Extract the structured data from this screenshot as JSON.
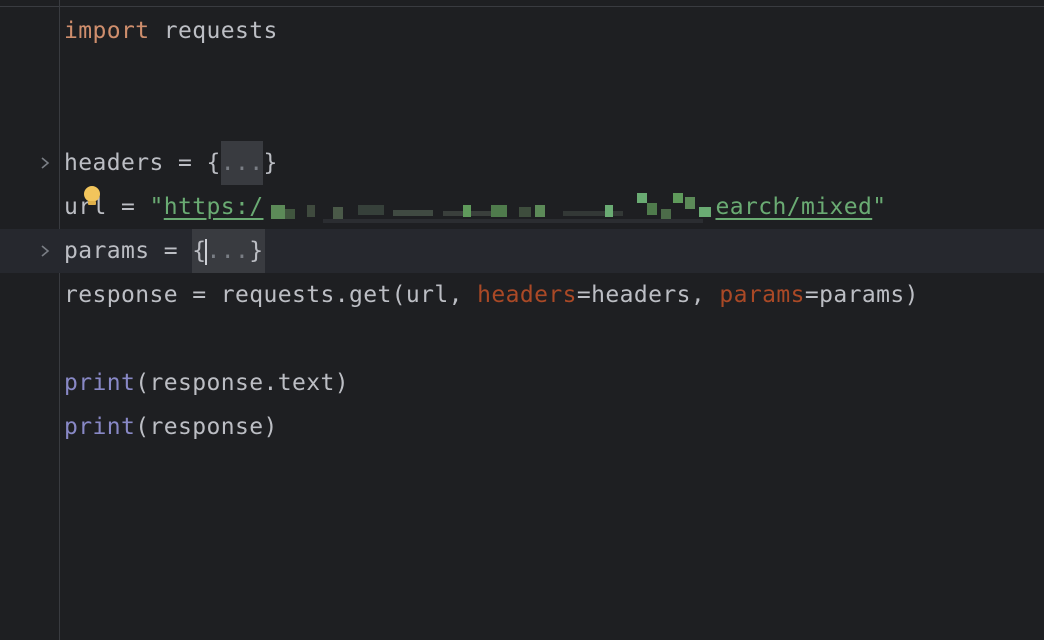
{
  "editor": {
    "language": "python",
    "lines": {
      "l1": {
        "keyword": "import",
        "module": "requests"
      },
      "l4": {
        "name": "headers",
        "op": " = ",
        "open": "{",
        "placeholder": "...",
        "close": "}"
      },
      "l5": {
        "name": "url",
        "op": " = ",
        "quote_open": "\"",
        "url_start": "https:/",
        "url_end": "earch/mixed",
        "quote_close": "\""
      },
      "l6": {
        "name": "params",
        "op": " = ",
        "open": "{",
        "placeholder": "...",
        "close": "}"
      },
      "l7": {
        "prefix": "response = requests.get(url, ",
        "arg1_name": "headers",
        "arg1_rest": "=headers, ",
        "arg2_name": "params",
        "arg2_rest": "=params)"
      },
      "l9": {
        "func": "print",
        "args": "(response.text)"
      },
      "l10": {
        "func": "print",
        "args": "(response)"
      }
    },
    "colors": {
      "background": "#1e1f22",
      "current_line": "#26282e",
      "keyword": "#cf8e6d",
      "builtin": "#8888c6",
      "named_arg": "#aa4926",
      "string": "#6aab73",
      "text": "#bcbec4",
      "intention_bulb": "#f2c55c"
    },
    "icons": [
      "fold-chevron-icon",
      "intention-bulb-icon"
    ]
  }
}
